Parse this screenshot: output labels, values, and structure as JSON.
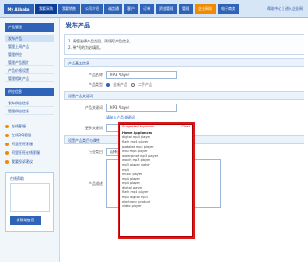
{
  "header": {
    "brand": "My Alibaba",
    "nav": [
      "我要采购",
      "我要销售",
      "公司介绍",
      "诚信通",
      "客户",
      "订单",
      "资金管理",
      "管理",
      "企业网站",
      "电子商务"
    ],
    "right_links": "帮助中心 | 进入企业网"
  },
  "sidebar": {
    "section_title": "产品管理",
    "items": [
      "发布产品",
      "管理上网产品",
      "管理供应",
      "管理产品图片",
      "产品价格设置",
      "管理相关产品"
    ],
    "section_title_2": "供应信息",
    "items_2": [
      "发布供应信息",
      "管理供应信息"
    ],
    "tools_title": "在线客服",
    "tools": [
      "在线QQ客服",
      "阿里旺旺客服",
      "阿里旺旺在线客服",
      "我要投诉建议"
    ],
    "box_title": "在线帮助",
    "box_button": "发帮助信息"
  },
  "main": {
    "title": "发布产品",
    "intro_1": "1. 请您选择产品类目，再填写产品信息。",
    "intro_2": "2. 带*号的为必填项。",
    "section_1": "产品基本信息",
    "product_name_label": "产品名称",
    "product_name_value": "MP3 Player",
    "product_type_label": "产品类型",
    "product_type_opt1": "全新产品",
    "product_type_opt2": "二手产品",
    "section_2": "设置产品关键词",
    "keyword_label": "产品关键词",
    "keyword_value": "MP3 Player",
    "keyword_hint": "请输入产品关键词",
    "more_label": "更多关键词",
    "section_3": "设置产品类目与属性",
    "category_label": "行业类目",
    "category_value": "选择类目",
    "hint_text": "为您推荐的类目",
    "bottom_label": "产品描述"
  },
  "dropdown": {
    "title": "Suggested keywords",
    "close": "Close",
    "items": [
      "Home Appliances",
      "digital mp4 player",
      "flash mp4 player",
      "portable mp3 player",
      "mini mp3 player",
      "waterproof mp3 player",
      "watch mp3 player",
      "mp3 player watch",
      "mp4",
      "music player",
      "mp4 player",
      "mp4 player",
      "digital player",
      "flash mp4 player",
      "mp4 digital mp3",
      "electronic product",
      "video player"
    ]
  }
}
